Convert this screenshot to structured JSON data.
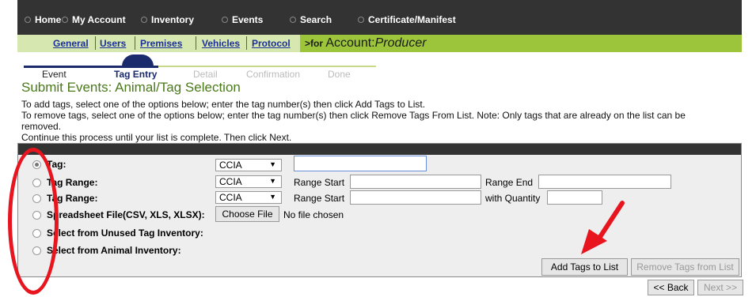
{
  "top_nav": {
    "items": [
      "Home",
      "My Account",
      "Inventory",
      "Events",
      "Search",
      "Certificate/Manifest"
    ]
  },
  "sub_nav": {
    "tabs": [
      "General",
      "Users",
      "Premises",
      "Vehicles",
      "Protocol"
    ],
    "account_prefix": ">for",
    "account_word": "Account:",
    "account_name": "Producer"
  },
  "stepper": {
    "steps": [
      "Event",
      "Tag Entry",
      "Detail",
      "Confirmation",
      "Done"
    ],
    "current_index": 1,
    "colors": {
      "done": "#1a2a6c",
      "pending": "#bbbbbb",
      "accent": "#9cc53c"
    }
  },
  "page": {
    "title": "Submit Events: Animal/Tag Selection",
    "instructions": [
      "To add tags, select one of the options below; enter the tag number(s) then click Add Tags to List.",
      "To remove tags, select one of the options below; enter the tag number(s) then click Remove Tags From List. Note: Only tags that are already on the list can be",
      "removed.",
      "Continue this process until your list is complete. Then click Next."
    ]
  },
  "form": {
    "options": [
      "Tag:",
      "Tag Range:",
      "Tag Range:",
      "Spreadsheet File(CSV, XLS, XLSX):",
      "Select from Unused Tag Inventory:",
      "Select from Animal Inventory:"
    ],
    "selected_index": 0,
    "tag_type": "CCIA",
    "range_start_label": "Range Start",
    "range_end_label": "Range End",
    "with_quantity_label": "with Quantity",
    "choose_file_label": "Choose File",
    "no_file_text": "No file chosen",
    "add_button": "Add Tags to List",
    "remove_button": "Remove Tags from List"
  },
  "footer": {
    "back_button": "<< Back",
    "next_button": "Next >>"
  },
  "colors": {
    "nav_bg": "#333333",
    "subnav_bg": "#d7e7b0",
    "account_bg": "#9cc53c",
    "title_green": "#4a7a1a",
    "annotation_red": "#e8141e"
  }
}
